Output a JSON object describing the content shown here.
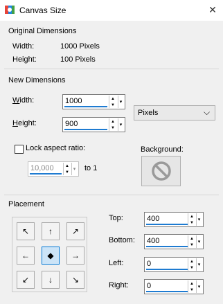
{
  "window": {
    "title": "Canvas Size",
    "close_glyph": "✕",
    "app_icon": "paintshop-icon"
  },
  "original": {
    "group_label": "Original Dimensions",
    "width_label": "Width:",
    "width_value": "1000 Pixels",
    "height_label": "Height:",
    "height_value": "100 Pixels"
  },
  "new_dims": {
    "group_label": "New Dimensions",
    "width_label": "Width:",
    "width_value": "1000",
    "height_label": "Height:",
    "height_value": "900",
    "units_selected": "Pixels",
    "lock_label": "Lock aspect ratio:",
    "lock_checked": false,
    "ratio_value": "10,000",
    "ratio_suffix": "to 1",
    "background_label": "Background:"
  },
  "placement": {
    "group_label": "Placement",
    "top_label": "Top:",
    "top_value": "400",
    "bottom_label": "Bottom:",
    "bottom_value": "400",
    "left_label": "Left:",
    "left_value": "0",
    "right_label": "Right:",
    "right_value": "0",
    "grid": [
      {
        "name": "placement-top-left",
        "glyph": "↖",
        "active": false
      },
      {
        "name": "placement-top-center",
        "glyph": "↑",
        "active": false
      },
      {
        "name": "placement-top-right",
        "glyph": "↗",
        "active": false
      },
      {
        "name": "placement-middle-left",
        "glyph": "←",
        "active": false
      },
      {
        "name": "placement-center",
        "glyph": "◆",
        "active": true
      },
      {
        "name": "placement-middle-right",
        "glyph": "→",
        "active": false
      },
      {
        "name": "placement-bottom-left",
        "glyph": "↙",
        "active": false
      },
      {
        "name": "placement-bottom-center",
        "glyph": "↓",
        "active": false
      },
      {
        "name": "placement-bottom-right",
        "glyph": "↘",
        "active": false
      }
    ]
  },
  "colors": {
    "accent": "#1e7bd1",
    "active_border": "#0078d7"
  }
}
